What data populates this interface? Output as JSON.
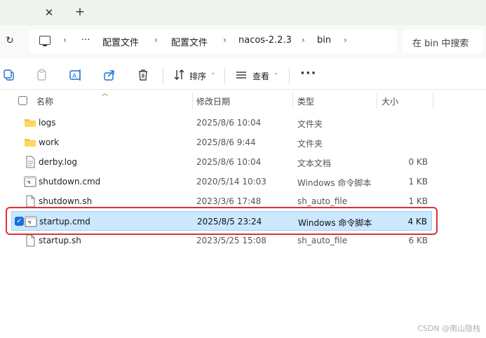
{
  "addressbar": {
    "crumbs": [
      "配置文件",
      "配置文件",
      "nacos-2.2.3",
      "bin"
    ],
    "ellipsis": "···",
    "search_placeholder": "在 bin 中搜索"
  },
  "toolbar": {
    "sort_label": "排序",
    "view_label": "查看",
    "more_label": "···"
  },
  "columns": {
    "name": "名称",
    "modified": "修改日期",
    "type": "类型",
    "size": "大小"
  },
  "files": [
    {
      "name": "logs",
      "modified": "2025/8/6 10:04",
      "type": "文件夹",
      "size": "",
      "icon": "folder-icon",
      "selected": false
    },
    {
      "name": "work",
      "modified": "2025/8/6 9:44",
      "type": "文件夹",
      "size": "",
      "icon": "folder-icon",
      "selected": false
    },
    {
      "name": "derby.log",
      "modified": "2025/8/6 10:04",
      "type": "文本文档",
      "size": "0 KB",
      "icon": "text-file-icon",
      "selected": false
    },
    {
      "name": "shutdown.cmd",
      "modified": "2020/5/14 10:03",
      "type": "Windows 命令脚本",
      "size": "1 KB",
      "icon": "cmd-file-icon",
      "selected": false
    },
    {
      "name": "shutdown.sh",
      "modified": "2023/3/6 17:48",
      "type": "sh_auto_file",
      "size": "1 KB",
      "icon": "file-icon",
      "selected": false
    },
    {
      "name": "startup.cmd",
      "modified": "2025/8/5 23:24",
      "type": "Windows 命令脚本",
      "size": "4 KB",
      "icon": "cmd-file-icon",
      "selected": true
    },
    {
      "name": "startup.sh",
      "modified": "2023/5/25 15:08",
      "type": "sh_auto_file",
      "size": "6 KB",
      "icon": "file-icon",
      "selected": false
    }
  ],
  "watermark": "CSDN @南山隐栈",
  "colors": {
    "selection_bg": "#cce8ff",
    "highlight_border": "#e03030",
    "folder": "#f5c242",
    "accent": "#1a6fd8"
  }
}
